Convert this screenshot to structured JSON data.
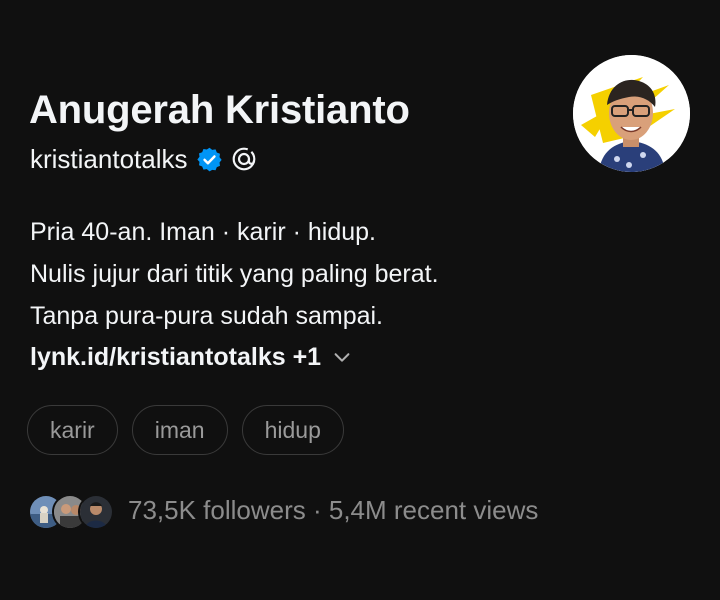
{
  "profile": {
    "display_name": "Anugerah Kristianto",
    "handle": "kristiantotalks",
    "verified_icon": "verified-badge-icon",
    "threads_icon": "threads-logo-icon",
    "avatar_alt": "profile photo",
    "accent_color": "#0095f6",
    "avatar_bg": "#f5d000"
  },
  "bio": {
    "lines": [
      "Pria 40-an. Iman · karir · hidup.",
      "Nulis jujur dari titik yang paling berat.",
      "Tanpa pura-pura sudah sampai."
    ]
  },
  "link": {
    "text": "lynk.id/kristiantotalks +1",
    "icon": "chevron-down-icon"
  },
  "tags": [
    "karir",
    "iman",
    "hidup"
  ],
  "stats": {
    "text": "73,5K followers · 5,4M recent views"
  }
}
